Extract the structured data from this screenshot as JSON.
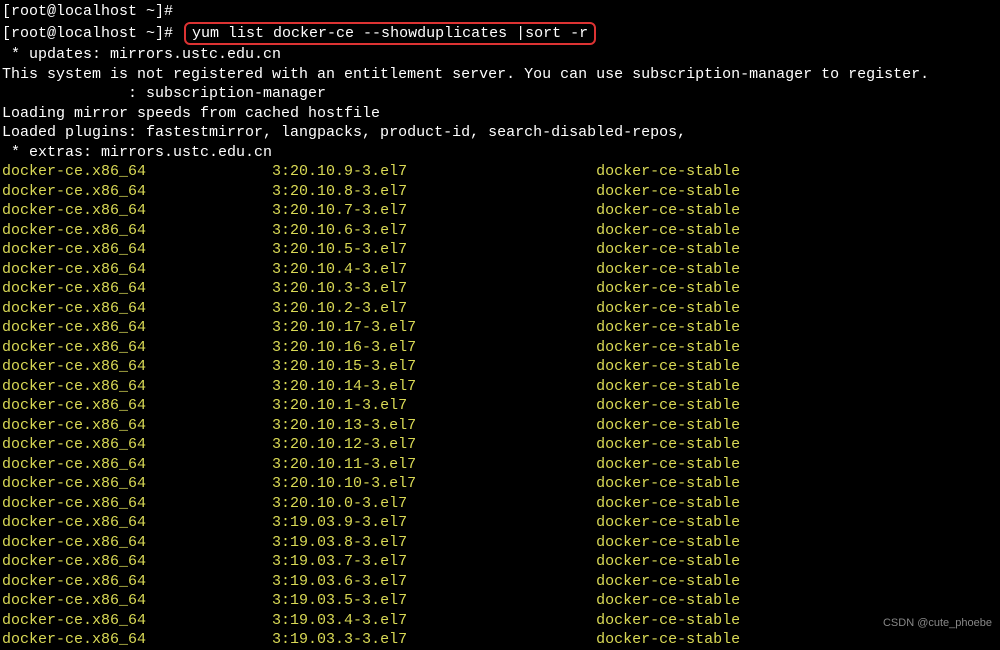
{
  "prompt1": "[root@localhost ~]#",
  "prompt2": "[root@localhost ~]# ",
  "command": "yum list docker-ce --showduplicates |sort -r",
  "info_lines": [
    " * updates: mirrors.ustc.edu.cn",
    "This system is not registered with an entitlement server. You can use subscription-manager to register.",
    "              : subscription-manager",
    "Loading mirror speeds from cached hostfile",
    "Loaded plugins: fastestmirror, langpacks, product-id, search-disabled-repos,",
    " * extras: mirrors.ustc.edu.cn"
  ],
  "packages": [
    {
      "name": "docker-ce.x86_64",
      "version": "3:20.10.9-3.el7",
      "repo": "docker-ce-stable"
    },
    {
      "name": "docker-ce.x86_64",
      "version": "3:20.10.8-3.el7",
      "repo": "docker-ce-stable"
    },
    {
      "name": "docker-ce.x86_64",
      "version": "3:20.10.7-3.el7",
      "repo": "docker-ce-stable"
    },
    {
      "name": "docker-ce.x86_64",
      "version": "3:20.10.6-3.el7",
      "repo": "docker-ce-stable"
    },
    {
      "name": "docker-ce.x86_64",
      "version": "3:20.10.5-3.el7",
      "repo": "docker-ce-stable"
    },
    {
      "name": "docker-ce.x86_64",
      "version": "3:20.10.4-3.el7",
      "repo": "docker-ce-stable"
    },
    {
      "name": "docker-ce.x86_64",
      "version": "3:20.10.3-3.el7",
      "repo": "docker-ce-stable"
    },
    {
      "name": "docker-ce.x86_64",
      "version": "3:20.10.2-3.el7",
      "repo": "docker-ce-stable"
    },
    {
      "name": "docker-ce.x86_64",
      "version": "3:20.10.17-3.el7",
      "repo": "docker-ce-stable"
    },
    {
      "name": "docker-ce.x86_64",
      "version": "3:20.10.16-3.el7",
      "repo": "docker-ce-stable"
    },
    {
      "name": "docker-ce.x86_64",
      "version": "3:20.10.15-3.el7",
      "repo": "docker-ce-stable"
    },
    {
      "name": "docker-ce.x86_64",
      "version": "3:20.10.14-3.el7",
      "repo": "docker-ce-stable"
    },
    {
      "name": "docker-ce.x86_64",
      "version": "3:20.10.1-3.el7",
      "repo": "docker-ce-stable"
    },
    {
      "name": "docker-ce.x86_64",
      "version": "3:20.10.13-3.el7",
      "repo": "docker-ce-stable"
    },
    {
      "name": "docker-ce.x86_64",
      "version": "3:20.10.12-3.el7",
      "repo": "docker-ce-stable"
    },
    {
      "name": "docker-ce.x86_64",
      "version": "3:20.10.11-3.el7",
      "repo": "docker-ce-stable"
    },
    {
      "name": "docker-ce.x86_64",
      "version": "3:20.10.10-3.el7",
      "repo": "docker-ce-stable"
    },
    {
      "name": "docker-ce.x86_64",
      "version": "3:20.10.0-3.el7",
      "repo": "docker-ce-stable"
    },
    {
      "name": "docker-ce.x86_64",
      "version": "3:19.03.9-3.el7",
      "repo": "docker-ce-stable"
    },
    {
      "name": "docker-ce.x86_64",
      "version": "3:19.03.8-3.el7",
      "repo": "docker-ce-stable"
    },
    {
      "name": "docker-ce.x86_64",
      "version": "3:19.03.7-3.el7",
      "repo": "docker-ce-stable"
    },
    {
      "name": "docker-ce.x86_64",
      "version": "3:19.03.6-3.el7",
      "repo": "docker-ce-stable"
    },
    {
      "name": "docker-ce.x86_64",
      "version": "3:19.03.5-3.el7",
      "repo": "docker-ce-stable"
    },
    {
      "name": "docker-ce.x86_64",
      "version": "3:19.03.4-3.el7",
      "repo": "docker-ce-stable"
    },
    {
      "name": "docker-ce.x86_64",
      "version": "3:19.03.3-3.el7",
      "repo": "docker-ce-stable"
    }
  ],
  "watermark": "CSDN @cute_phoebe",
  "col_widths": {
    "name": 30,
    "version": 36
  }
}
